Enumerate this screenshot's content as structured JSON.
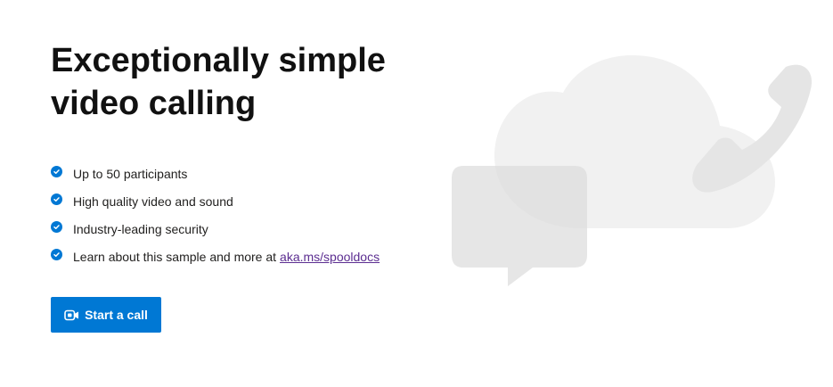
{
  "hero": {
    "title_line1": "Exceptionally simple",
    "title_line2": "video calling"
  },
  "features": [
    {
      "text": "Up to 50 participants",
      "icon": "check-circle-icon"
    },
    {
      "text": "High quality video and sound",
      "icon": "check-circle-icon"
    },
    {
      "text": "Industry-leading security",
      "icon": "check-circle-icon"
    },
    {
      "text": "Learn about this sample and more at",
      "link": "aka.ms/spooldocs",
      "icon": "check-circle-icon"
    }
  ],
  "start_button": {
    "label": "Start a call",
    "icon": "video-camera-icon"
  },
  "illustration": {
    "icons": [
      "cloud-icon",
      "phone-icon",
      "chat-bubble-icon"
    ]
  },
  "colors": {
    "accent": "#0078d4",
    "link": "#5c2e91",
    "illustration_light": "#f1f1f1",
    "illustration_dark": "#e4e4e4"
  }
}
